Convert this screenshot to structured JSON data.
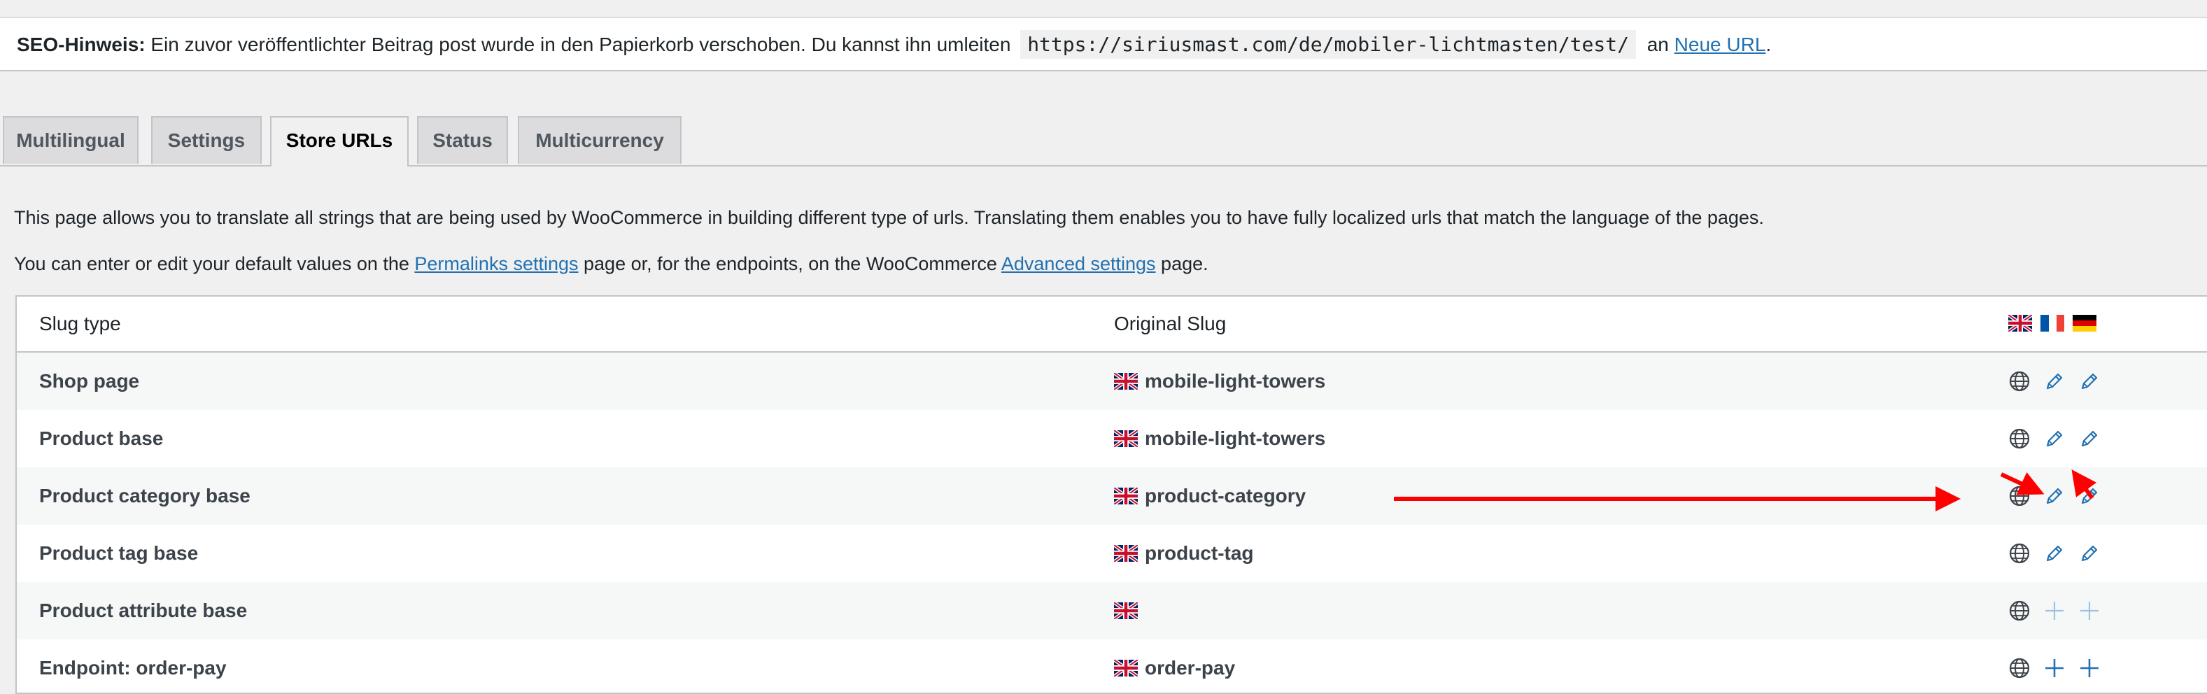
{
  "notice": {
    "label": "SEO-Hinweis:",
    "message": "Ein zuvor veröffentlichter Beitrag post wurde in den Papierkorb verschoben. Du kannst ihn umleiten",
    "url": "https://siriusmast.com/de/mobiler-lichtmasten/test/",
    "connector": "an",
    "link": "Neue URL",
    "end": "."
  },
  "tabs": [
    {
      "label": "Multilingual"
    },
    {
      "label": "Settings"
    },
    {
      "label": "Store URLs",
      "active": true
    },
    {
      "label": "Status"
    },
    {
      "label": "Multicurrency"
    }
  ],
  "intro": {
    "line1": "This page allows you to translate all strings that are being used by WooCommerce in building different type of urls. Translating them enables you to have fully localized urls that match the language of the pages.",
    "line2_pre": "You can enter or edit your default values on the",
    "line2_link1": "Permalinks settings",
    "line2_mid": "page or, for the endpoints, on the WooCommerce",
    "line2_link2": "Advanced settings",
    "line2_post": "page."
  },
  "table": {
    "headers": {
      "slug_type": "Slug type",
      "original_slug": "Original Slug"
    },
    "header_flags": [
      "flag-uk-icon",
      "flag-fr-icon",
      "flag-de-icon"
    ],
    "rows": [
      {
        "type": "Shop page",
        "slug": "mobile-light-towers",
        "actions": [
          "globe",
          "pencil",
          "pencil"
        ]
      },
      {
        "type": "Product base",
        "slug": "mobile-light-towers",
        "actions": [
          "globe",
          "pencil",
          "pencil"
        ]
      },
      {
        "type": "Product category base",
        "slug": "product-category",
        "actions": [
          "globe",
          "pencil",
          "pencil"
        ]
      },
      {
        "type": "Product tag base",
        "slug": "product-tag",
        "actions": [
          "globe",
          "pencil",
          "pencil"
        ]
      },
      {
        "type": "Product attribute base",
        "slug": "",
        "actions": [
          "globe",
          "plus-light",
          "plus-light"
        ]
      },
      {
        "type": "Endpoint: order-pay",
        "slug": "order-pay",
        "actions": [
          "globe",
          "plus",
          "plus"
        ]
      }
    ]
  },
  "colors": {
    "link": "#2271b1",
    "annotation_arrow": "#ff0000",
    "action_icon": "#2271b1",
    "globe_icon": "#3c434a"
  }
}
